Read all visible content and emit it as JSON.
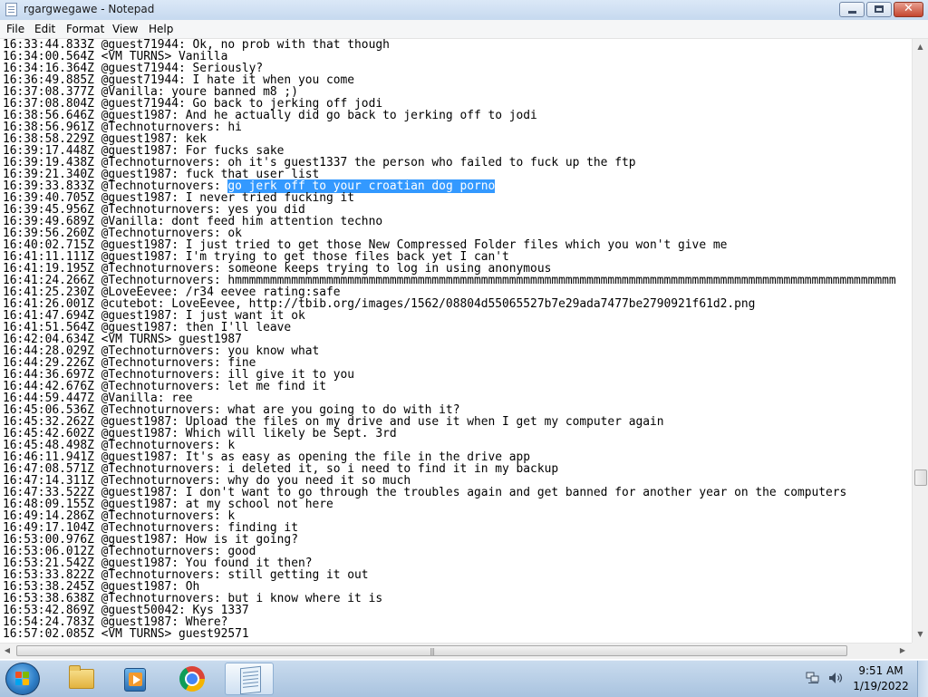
{
  "window": {
    "title": "rgargwegawe - Notepad"
  },
  "menu": [
    "File",
    "Edit",
    "Format",
    "View",
    "Help"
  ],
  "editor": {
    "lines": [
      "16:33:44.833Z @guest71944: Ok, no prob with that though",
      "16:34:00.564Z <VM TURNS> Vanilla",
      "16:34:16.364Z @guest71944: Seriously?",
      "16:36:49.885Z @guest71944: I hate it when you come",
      "16:37:08.377Z @Vanilla: youre banned m8 ;)",
      "16:37:08.804Z @guest71944: Go back to jerking off jodi",
      "16:38:56.646Z @guest1987: And he actually did go back to jerking off to jodi",
      "16:38:56.961Z @Technoturnovers: hi",
      "16:38:58.229Z @guest1987: kek",
      "16:39:17.448Z @guest1987: For fucks sake",
      "16:39:19.438Z @Technoturnovers: oh it's guest1337 the person who failed to fuck up the ftp",
      "16:39:21.340Z @guest1987: fuck that user list",
      "16:39:33.833Z @Technoturnovers: ",
      "16:39:40.705Z @guest1987: I never tried fucking it",
      "16:39:45.956Z @Technoturnovers: yes you did",
      "16:39:49.689Z @Vanilla: dont feed him attention techno",
      "16:39:56.260Z @Technoturnovers: ok",
      "16:40:02.715Z @guest1987: I just tried to get those New Compressed Folder files which you won't give me",
      "16:41:11.111Z @guest1987: I'm trying to get those files back yet I can't",
      "16:41:19.195Z @Technoturnovers: someone keeps trying to log in using anonymous",
      "16:41:24.266Z @Technoturnovers: hmmmmmmmmmmmmmmmmmmmmmmmmmmmmmmmmmmmmmmmmmmmmmmmmmmmmmmmmmmmmmmmmmmmmmmmmmmmmmmmmmmmmmmmmmmmmmm",
      "16:41:25.230Z @LoveEevee: /r34 eevee rating:safe",
      "16:41:26.001Z @cutebot: LoveEevee, http://tbib.org/images/1562/08804d55065527b7e29ada7477be2790921f61d2.png",
      "16:41:47.694Z @guest1987: I just want it ok",
      "16:41:51.564Z @guest1987: then I'll leave",
      "16:42:04.634Z <VM TURNS> guest1987",
      "16:44:28.029Z @Technoturnovers: you know what",
      "16:44:29.226Z @Technoturnovers: fine",
      "16:44:36.697Z @Technoturnovers: ill give it to you",
      "16:44:42.676Z @Technoturnovers: let me find it",
      "16:44:59.447Z @Vanilla: ree",
      "16:45:06.536Z @Technoturnovers: what are you going to do with it?",
      "16:45:32.262Z @guest1987: Upload the files on my drive and use it when I get my computer again",
      "16:45:42.602Z @guest1987: Which will likely be Sept. 3rd",
      "16:45:48.498Z @Technoturnovers: k",
      "16:46:11.941Z @guest1987: It's as easy as opening the file in the drive app",
      "16:47:08.571Z @Technoturnovers: i deleted it, so i need to find it in my backup",
      "16:47:14.311Z @Technoturnovers: why do you need it so much",
      "16:47:33.522Z @guest1987: I don't want to go through the troubles again and get banned for another year on the computers",
      "16:48:09.155Z @guest1987: at my school not here",
      "16:49:14.286Z @Technoturnovers: k",
      "16:49:17.104Z @Technoturnovers: finding it",
      "16:53:00.976Z @guest1987: How is it going?",
      "16:53:06.012Z @Technoturnovers: good",
      "16:53:21.542Z @guest1987: You found it then?",
      "16:53:33.822Z @Technoturnovers: still getting it out",
      "16:53:38.245Z @guest1987: Oh",
      "16:53:38.638Z @Technoturnovers: but i know where it is",
      "16:53:42.869Z @guest50042: Kys 1337",
      "16:54:24.783Z @guest1987: Where?",
      "16:57:02.085Z <VM TURNS> guest92571"
    ],
    "selection": {
      "line": 12,
      "text": "go jerk off to your croatian dog porno"
    }
  },
  "taskbar": {
    "apps": [
      {
        "icon": "folder-icon",
        "label": "Windows Explorer"
      },
      {
        "icon": "media-player-icon",
        "label": "Windows Media Player"
      },
      {
        "icon": "chrome-icon",
        "label": "Google Chrome"
      },
      {
        "icon": "notepad-icon",
        "label": "Notepad",
        "active": true
      }
    ],
    "clock": {
      "time": "9:51 AM",
      "date": "1/19/2022"
    }
  },
  "colors": {
    "selection": "#3399ff",
    "taskbar": "#b9cfe7",
    "titlebar": "#cfdff2"
  }
}
